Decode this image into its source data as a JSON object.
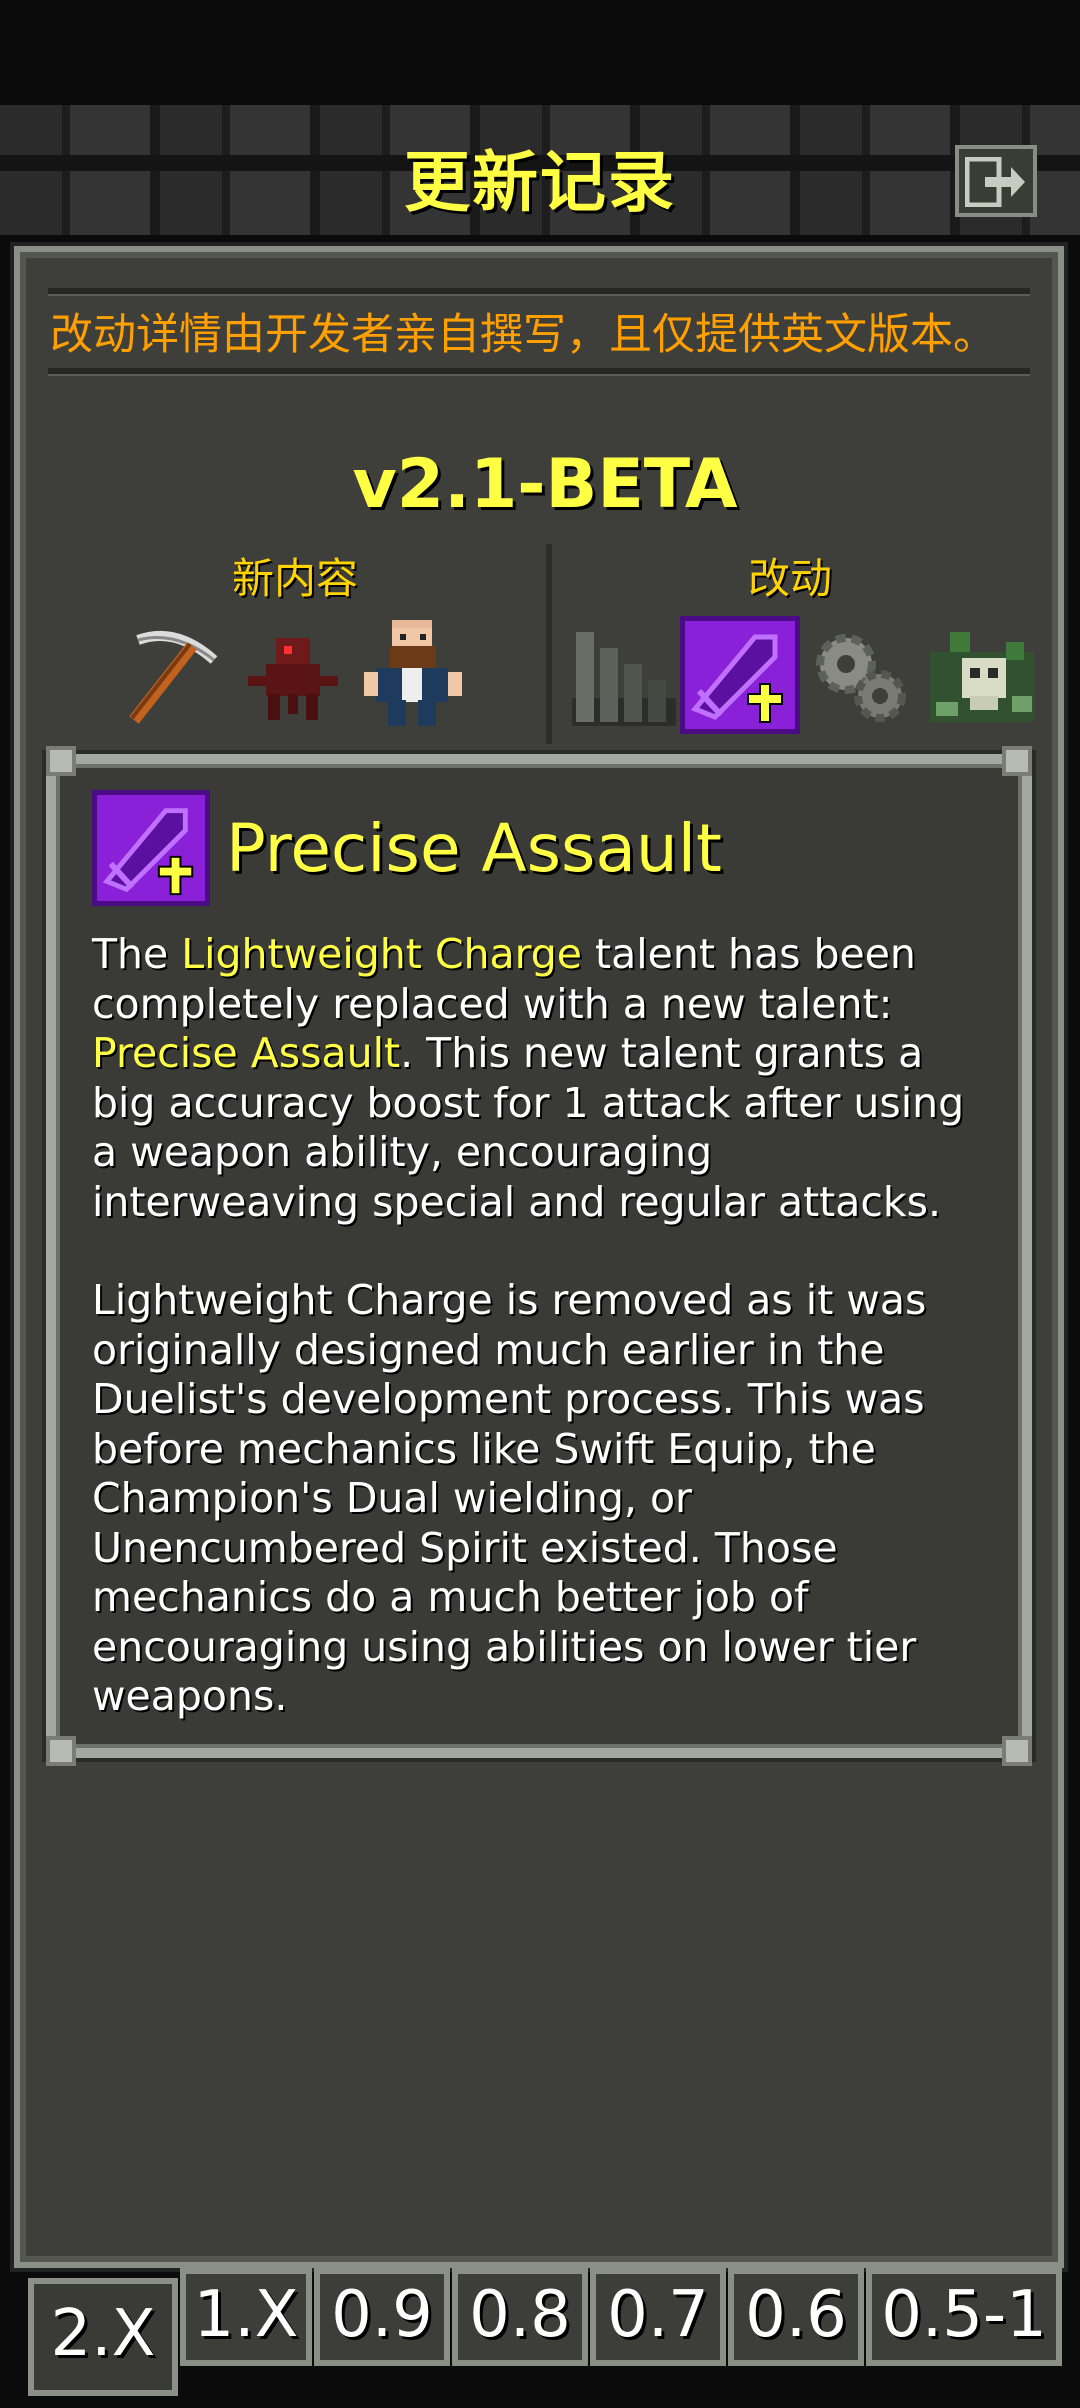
{
  "header": {
    "title": "更新记录",
    "exit_icon": "exit-door-icon"
  },
  "notice": {
    "text": "改动详情由开发者亲自撰写，且仅提供英文版本。"
  },
  "version": {
    "label": "v2.1-BETA"
  },
  "sections": {
    "new_content_label": "新内容",
    "changes_label": "改动",
    "new_content_icons": [
      "pickaxe-icon",
      "red-creature-icon",
      "bearded-man-npc-icon"
    ],
    "change_icons": [
      "stairs-icon",
      "precise-assault-talent-icon",
      "gears-icon",
      "green-skull-icon"
    ]
  },
  "detail": {
    "icon": "precise-assault-talent-icon",
    "title": "Precise Assault",
    "p1_a": "The ",
    "p1_hl1": "Lightweight Charge",
    "p1_b": " talent has been completely replaced with a new talent: ",
    "p1_hl2": "Precise Assault",
    "p1_c": ". This new talent grants a big accuracy boost for 1 attack after using a weapon ability, encouraging interweaving special and regular attacks.",
    "p2": "Lightweight Charge is removed as it was originally designed much earlier in the Duelist's development process. This was before mechanics like Swift Equip, the Champion's Dual wielding, or Unencumbered Spirit existed. Those mechanics do a much better job of encouraging using abilities on lower tier weapons."
  },
  "tabs": [
    {
      "label": "2.X",
      "active": true
    },
    {
      "label": "1.X",
      "active": false
    },
    {
      "label": "0.9",
      "active": false
    },
    {
      "label": "0.8",
      "active": false
    },
    {
      "label": "0.7",
      "active": false
    },
    {
      "label": "0.6",
      "active": false
    },
    {
      "label": "0.5-1",
      "active": false
    }
  ],
  "colors": {
    "accent_yellow": "#ffff44",
    "warning_orange": "#ffa000",
    "panel_bg": "#3e3f3a",
    "talent_purple": "#8a20d8"
  }
}
